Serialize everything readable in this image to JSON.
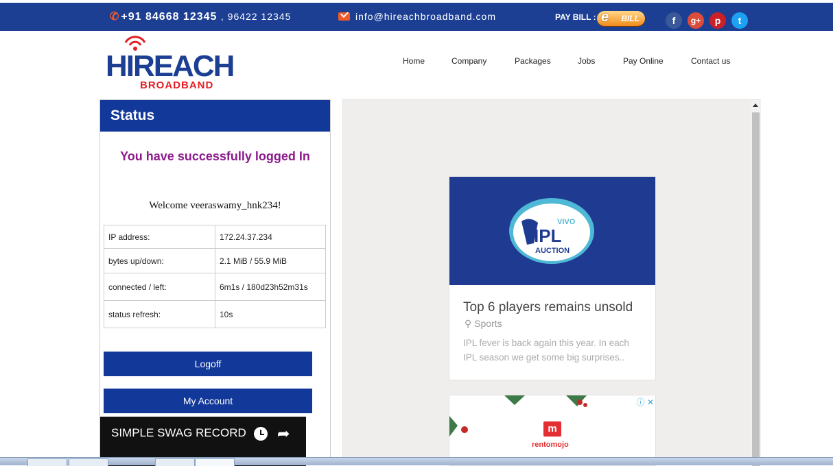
{
  "topbar": {
    "phone_primary": "+91 84668 12345",
    "phone_secondary": ", 96422 12345",
    "email": "info@hireachbroadband.com",
    "pay_bill_label": "PAY BILL :",
    "ebill_label": "BILL",
    "social": [
      {
        "icon": "facebook-icon",
        "glyph": "f"
      },
      {
        "icon": "google-plus-icon",
        "glyph": "g+"
      },
      {
        "icon": "pinterest-icon",
        "glyph": "p"
      },
      {
        "icon": "twitter-icon",
        "glyph": "t"
      }
    ]
  },
  "logo": {
    "main": "HIREACH",
    "sub": "BROADBAND"
  },
  "nav": {
    "items": [
      "Home",
      "Company",
      "Packages",
      "Jobs",
      "Pay Online",
      "Contact us"
    ]
  },
  "status": {
    "title": "Status",
    "success_message": "You have successfully logged In",
    "welcome": "Welcome veeraswamy_hnk234!",
    "rows": [
      {
        "label": "IP address:",
        "value": "172.24.37.234"
      },
      {
        "label": "bytes up/down:",
        "value": "2.1 MiB / 55.9 MiB"
      },
      {
        "label": "connected / left:",
        "value": "6m1s / 180d23h52m31s"
      },
      {
        "label": "status refresh:",
        "value": "10s"
      }
    ],
    "logoff_label": "Logoff",
    "account_label": "My Account"
  },
  "video": {
    "title": "SIMPLE SWAG RECORD"
  },
  "news_card": {
    "badge_top": "VIVO",
    "badge_main": "IPL",
    "badge_sub": "AUCTION",
    "title": "Top 6 players remains unsold",
    "category": "Sports",
    "description": "IPL fever is back again this year. In each IPL season we get some big surprises.."
  },
  "ad": {
    "brand": "rentomojo",
    "logo_letter": "m"
  },
  "colors": {
    "brand_blue": "#12389a",
    "accent_orange": "#f05a28",
    "success_purple": "#8b1a8b"
  }
}
